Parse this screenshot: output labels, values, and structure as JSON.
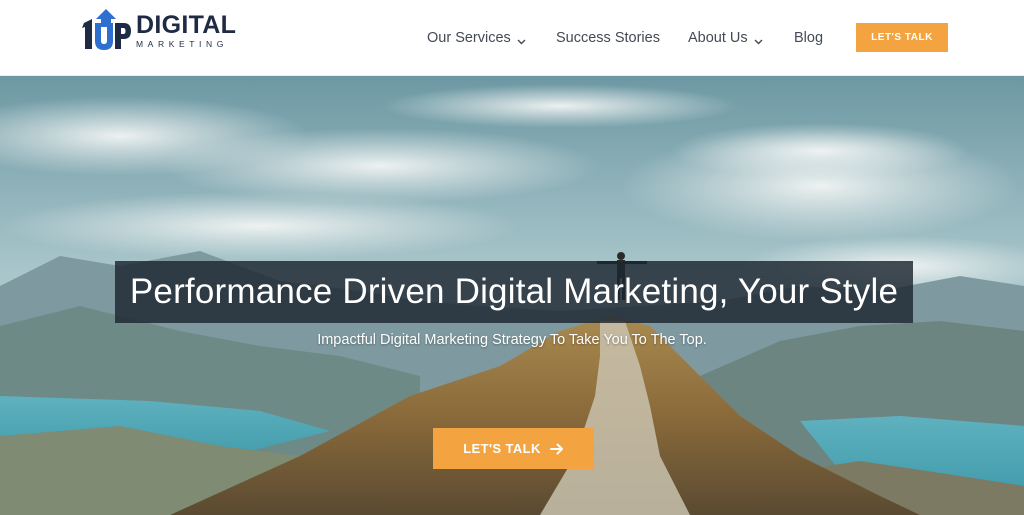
{
  "logo": {
    "word": "DIGITAL",
    "sub": "MARKETING",
    "mark_text": "1UP"
  },
  "nav": {
    "items": [
      {
        "label": "Our Services",
        "has_dropdown": true
      },
      {
        "label": "Success Stories",
        "has_dropdown": false
      },
      {
        "label": "About Us",
        "has_dropdown": true
      },
      {
        "label": "Blog",
        "has_dropdown": false
      }
    ],
    "cta_label": "LET'S TALK"
  },
  "hero": {
    "headline": "Performance Driven Digital Marketing, Your Style",
    "subhead": "Impactful Digital Marketing Strategy To Take You To The Top.",
    "cta_label": "LET'S TALK"
  },
  "colors": {
    "accent": "#f4a341",
    "brand_navy": "#1f2a44",
    "brand_blue": "#2e6fd0"
  },
  "icons": {
    "dropdown": "chevron-down-icon",
    "cta_arrow": "arrow-right-icon"
  }
}
